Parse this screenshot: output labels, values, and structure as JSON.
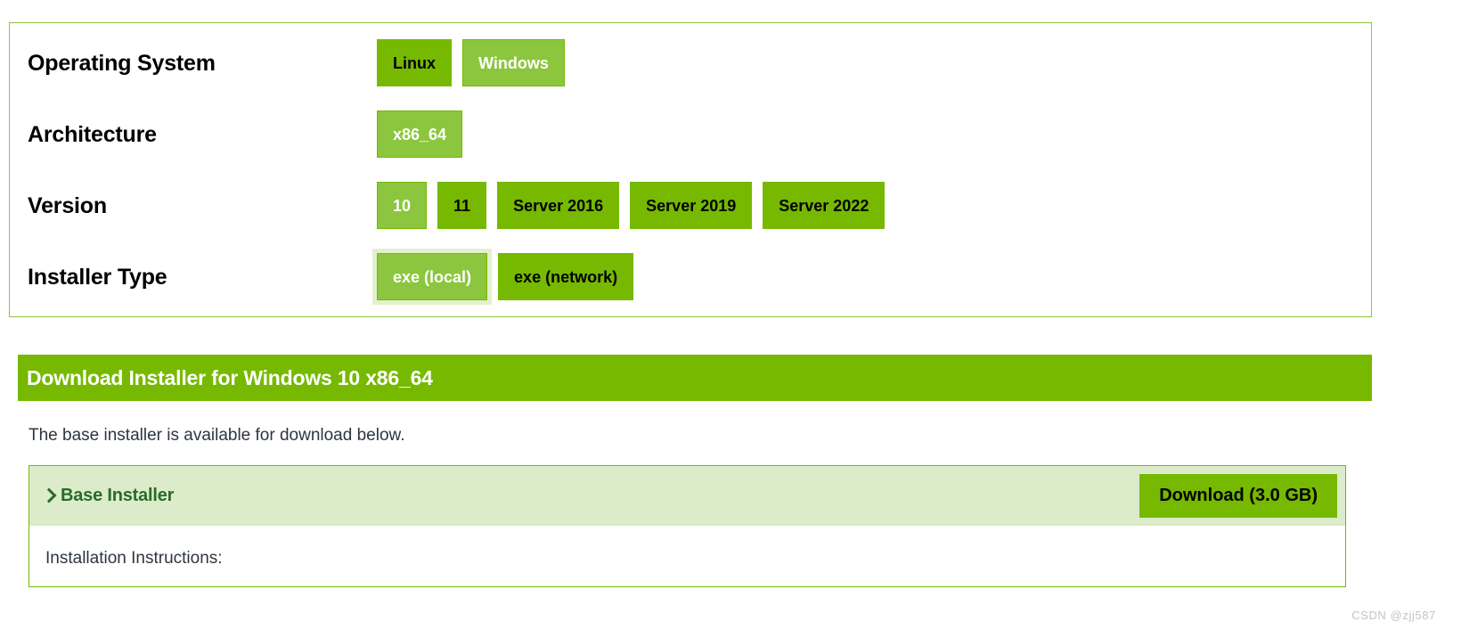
{
  "selector": {
    "rows": [
      {
        "label": "Operating System",
        "name": "operating-system",
        "options": [
          {
            "label": "Linux",
            "selected": false,
            "focused": false
          },
          {
            "label": "Windows",
            "selected": true,
            "focused": false
          }
        ]
      },
      {
        "label": "Architecture",
        "name": "architecture",
        "options": [
          {
            "label": "x86_64",
            "selected": true,
            "focused": false
          }
        ]
      },
      {
        "label": "Version",
        "name": "version",
        "options": [
          {
            "label": "10",
            "selected": true,
            "focused": false
          },
          {
            "label": "11",
            "selected": false,
            "focused": false
          },
          {
            "label": "Server 2016",
            "selected": false,
            "focused": false
          },
          {
            "label": "Server 2019",
            "selected": false,
            "focused": false
          },
          {
            "label": "Server 2022",
            "selected": false,
            "focused": false
          }
        ]
      },
      {
        "label": "Installer Type",
        "name": "installer-type",
        "options": [
          {
            "label": "exe (local)",
            "selected": true,
            "focused": true
          },
          {
            "label": "exe (network)",
            "selected": false,
            "focused": false
          }
        ]
      }
    ]
  },
  "download": {
    "header_title": "Download Installer for Windows 10 x86_64",
    "intro_text": "The base installer is available for download below.",
    "installer": {
      "title": "Base Installer",
      "download_button": "Download (3.0 GB)",
      "instructions_label": "Installation Instructions:"
    }
  },
  "watermark": "CSDN @zjj587",
  "colors": {
    "brand_green": "#76b900",
    "selected_green": "#8cc63e",
    "pale_green": "#dcecca",
    "dark_green_text": "#2a6b2a",
    "body_text": "#2d3640"
  }
}
